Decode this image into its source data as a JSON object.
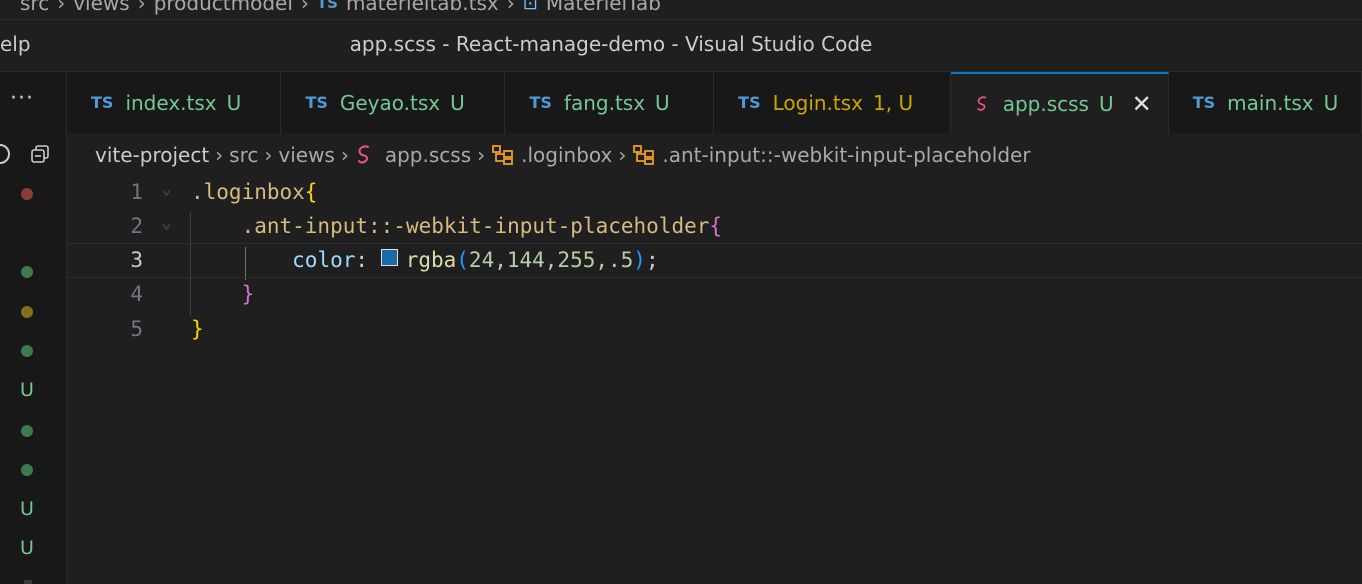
{
  "behind": {
    "crumbs": [
      "src",
      "views",
      "productmodel"
    ],
    "file_icon": "TS",
    "file": "materieltab.tsx",
    "symbol": "MaterielTab"
  },
  "titlebar": {
    "menu_fragment": "elp",
    "title": "app.scss - React-manage-demo - Visual Studio Code"
  },
  "leftstrip": {
    "more": "···",
    "status": [
      {
        "kind": "dot",
        "color": "#8c3b3b"
      },
      {
        "kind": "dot",
        "color": "#3f7a4f"
      },
      {
        "kind": "dot",
        "color": "#807020"
      },
      {
        "kind": "dot",
        "color": "#3f7a4f"
      },
      {
        "kind": "u",
        "text": "U"
      },
      {
        "kind": "dot",
        "color": "#3f7a4f"
      },
      {
        "kind": "dot",
        "color": "#3f7a4f"
      },
      {
        "kind": "u",
        "text": "U"
      },
      {
        "kind": "u",
        "text": "U"
      }
    ]
  },
  "tabs": [
    {
      "icon": "TS",
      "name": "index.tsx",
      "badge": "U"
    },
    {
      "icon": "TS",
      "name": "Geyao.tsx",
      "badge": "U"
    },
    {
      "icon": "TS",
      "name": "fang.tsx",
      "badge": "U"
    },
    {
      "icon": "TS",
      "name": "Login.tsx",
      "badge": "1, U"
    },
    {
      "icon": "sass",
      "name": "app.scss",
      "badge": "U",
      "close": "✕"
    },
    {
      "icon": "TS",
      "name": "main.tsx",
      "badge": "U"
    }
  ],
  "breadcrumb": {
    "items": [
      "vite-project",
      "src",
      "views",
      "app.scss",
      ".loginbox",
      ".ant-input::-webkit-input-placeholder"
    ]
  },
  "editor": {
    "line_numbers": [
      "1",
      "2",
      "3",
      "4",
      "5"
    ],
    "current_line": 3,
    "lines": {
      "l1_sel": ".loginbox",
      "l1_brace": "{",
      "l2_sel": ".ant-input::-webkit-input-placeholder",
      "l2_brace": "{",
      "l3_prop": "color",
      "l3_colon": ":",
      "l3_fn": "rgba",
      "l3_open": "(",
      "l3_args": "24,144,255,.5",
      "l3_close": ")",
      "l3_semi": ";",
      "l4_brace": "}",
      "l5_brace": "}"
    },
    "swatch_color": "#1a6aa8"
  },
  "colors": {
    "accent": "#0078d4",
    "untracked": "#73c991",
    "warning": "#cca700",
    "ts_icon": "#4e9bd5",
    "sass_icon": "#f55385"
  }
}
